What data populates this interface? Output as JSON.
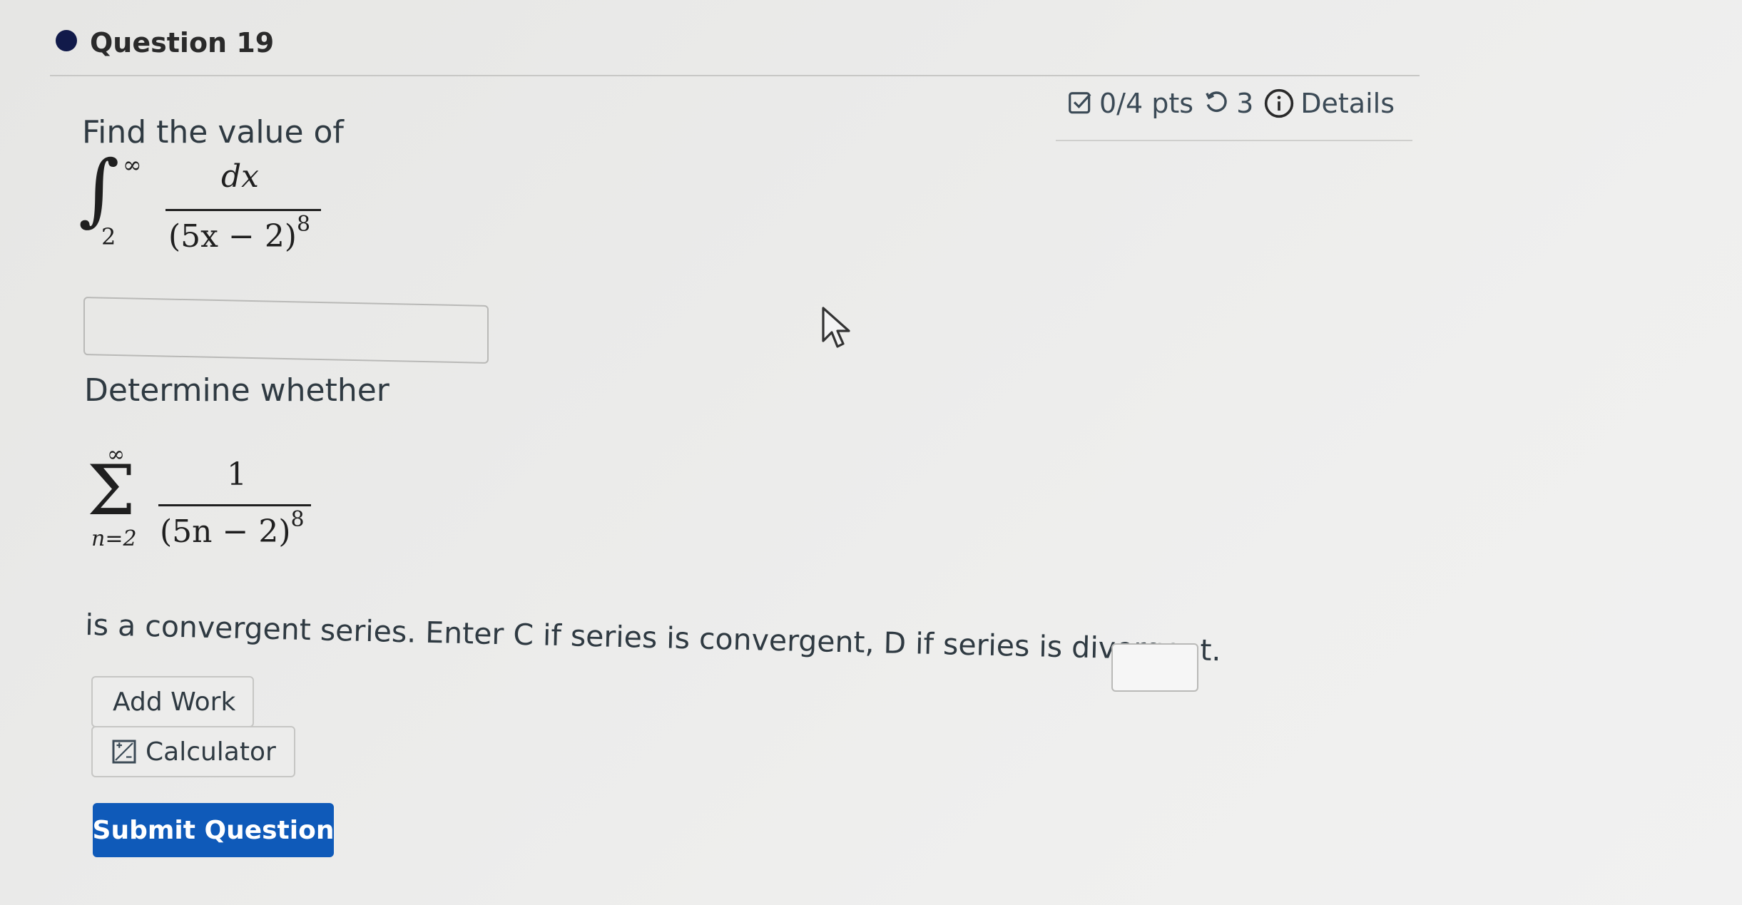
{
  "question": {
    "title": "Question 19",
    "points": "0/4 pts",
    "attempts": "3",
    "details_label": "Details"
  },
  "part1": {
    "prompt": "Find the value of",
    "integral": {
      "upper": "∞",
      "lower": "2",
      "numerator": "dx",
      "denominator_base": "(5x − 2)",
      "exponent": "8"
    },
    "answer_value": ""
  },
  "part2": {
    "prompt": "Determine whether",
    "series": {
      "upper": "∞",
      "lower": "n=2",
      "numerator": "1",
      "denominator_base": "(5n − 2)",
      "exponent": "8"
    },
    "statement": "is a convergent series. Enter C if series is convergent, D if series is divergent.",
    "answer_value": ""
  },
  "buttons": {
    "add_work": "Add Work",
    "calculator": "Calculator",
    "submit": "Submit Question"
  },
  "colors": {
    "submit_bg": "#0f5ab9",
    "dot": "#111a4a"
  },
  "icons": {
    "points": "checkbox-icon",
    "attempts": "retry-icon",
    "details": "info-circle-icon",
    "calculator": "calculator-icon",
    "cursor": "mouse-pointer-icon"
  }
}
